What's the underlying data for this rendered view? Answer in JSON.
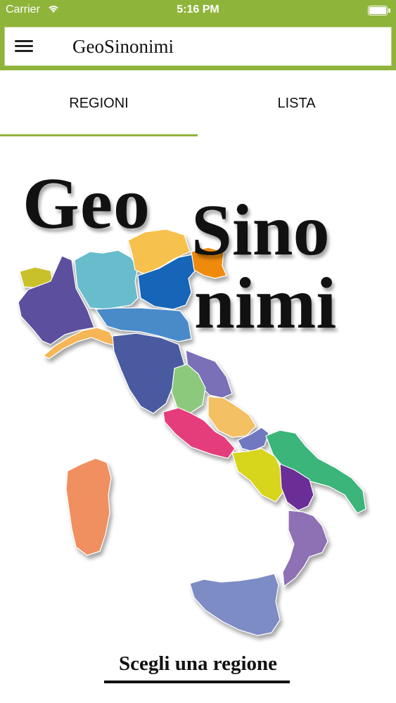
{
  "status_bar": {
    "carrier": "Carrier",
    "time": "5:16 PM"
  },
  "app_bar": {
    "title": "GeoSinonimi",
    "menu_icon": "hamburger-menu-icon",
    "accent_color": "#8fb43a"
  },
  "tabs": [
    {
      "label": "REGIONI",
      "selected": true
    },
    {
      "label": "LISTA",
      "selected": false
    }
  ],
  "logo": {
    "line1": "Geo",
    "line2": "Sino",
    "line3": "nimi"
  },
  "map": {
    "image": "italy-regions-map"
  },
  "cta": {
    "label": "Scegli una regione"
  }
}
